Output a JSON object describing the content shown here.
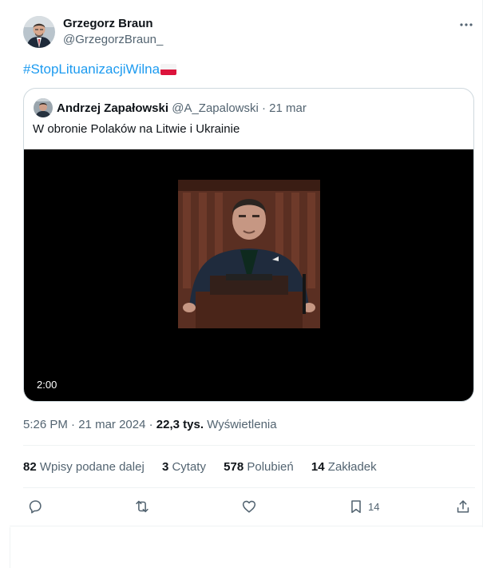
{
  "tweet": {
    "author_name": "Grzegorz Braun",
    "author_handle": "@GrzegorzBraun_",
    "hashtag": "#StopLituanizacjiWilna",
    "flag_icon": "poland-flag-icon",
    "more_icon": "more-options-icon"
  },
  "quoted": {
    "author_name": "Andrzej Zapałowski",
    "author_handle": "@A_Zapalowski",
    "separator": "·",
    "date": "21 mar",
    "text": "W obronie Polaków na Litwie i Ukrainie",
    "video_duration": "2:00"
  },
  "meta": {
    "time": "5:26 PM",
    "separator": "·",
    "date": "21 mar 2024",
    "views_count": "22,3 tys.",
    "views_label": "Wyświetlenia"
  },
  "stats": {
    "reposts_count": "82",
    "reposts_label": "Wpisy podane dalej",
    "quotes_count": "3",
    "quotes_label": "Cytaty",
    "likes_count": "578",
    "likes_label": "Polubień",
    "bookmarks_count": "14",
    "bookmarks_label": "Zakładek"
  },
  "actions": {
    "bookmark_count": "14"
  },
  "colors": {
    "accent": "#1d9bf0",
    "text": "#0f1419",
    "secondary": "#536471",
    "border": "#cfd9de"
  }
}
